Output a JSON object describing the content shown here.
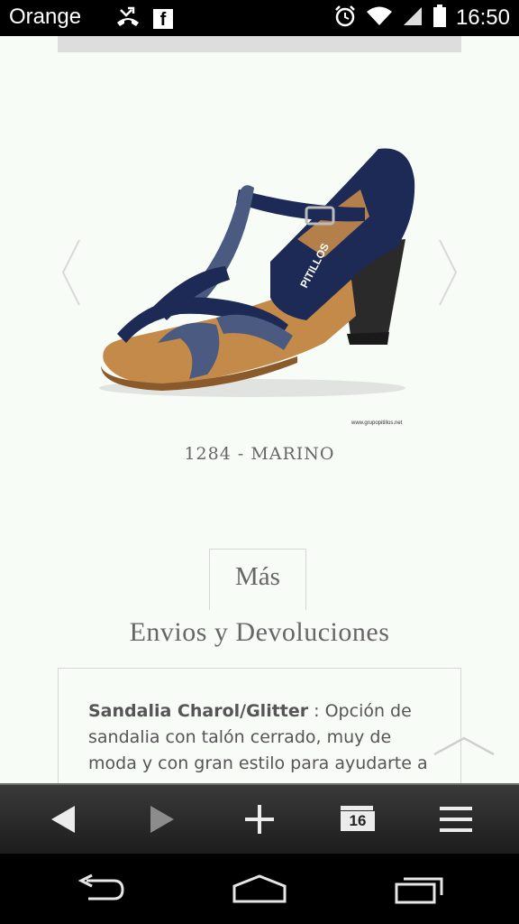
{
  "status_bar": {
    "carrier": "Orange",
    "time": "16:50",
    "facebook_glyph": "f",
    "icons": [
      "missed-call-icon",
      "facebook-icon",
      "alarm-icon",
      "wifi-icon",
      "signal-icon",
      "battery-icon"
    ]
  },
  "product": {
    "name": "1284 - MARINO",
    "brand_on_shoe": "PITILLOS",
    "watermark": "www.grupopitillos.net"
  },
  "tabs": {
    "more_label": "Más",
    "shipping_label": "Envios y Devoluciones"
  },
  "description": {
    "bold": "Sandalia Charol/Glitter",
    "text": " : Opción de sandalia con talón cerrado, muy de moda y con gran estilo para ayudarte a"
  },
  "browser_toolbar": {
    "tab_count": "16",
    "icons": [
      "back-icon",
      "forward-icon",
      "new-tab-icon",
      "tabs-icon",
      "menu-icon"
    ]
  },
  "android_nav": {
    "icons": [
      "nav-back-icon",
      "nav-home-icon",
      "nav-recents-icon"
    ]
  },
  "colors": {
    "background": "#f8fcf7",
    "shoe_navy": "#1c2a55",
    "shoe_tan": "#c48a4a",
    "heel": "#2a2a2a"
  }
}
